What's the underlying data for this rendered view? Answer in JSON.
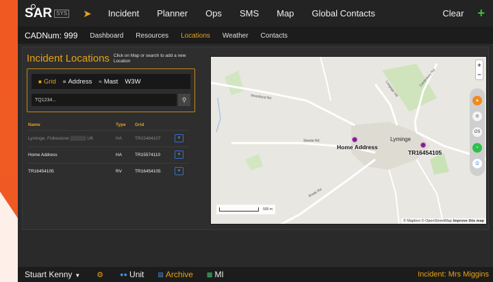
{
  "header": {
    "logo_s": "S",
    "logo_r": "AR",
    "logo_sys": "SYS",
    "nav": [
      "Incident",
      "Planner",
      "Ops",
      "SMS",
      "Map",
      "Global Contacts"
    ],
    "clear_label": "Clear",
    "add_label": "+"
  },
  "subnav": {
    "cad": "CADNum: 999",
    "tabs": [
      "Dashboard",
      "Resources",
      "Locations",
      "Weather",
      "Contacts"
    ],
    "active_tab": "Locations"
  },
  "locations": {
    "title": "Incident Locations",
    "hint": "Click on Map or search to add a new Location",
    "search_modes": [
      "Grid",
      "Address",
      "Mast",
      "W3W"
    ],
    "active_mode": "Grid",
    "search_placeholder": "TQ1234...",
    "table": {
      "headers": [
        "Name",
        "Type",
        "Grid"
      ],
      "rows": [
        {
          "name": "Lyminge, Folkestone ▒▒▒▒▒ UK",
          "type": "HA",
          "grid": "TR15484107"
        },
        {
          "name": "Home Address",
          "type": "HA",
          "grid": "TR15574110"
        },
        {
          "name": "TR16454105",
          "type": "RV",
          "grid": "TR16454105"
        }
      ]
    }
  },
  "map": {
    "labels": {
      "home": "Home Address",
      "lyminge": "Lyminge",
      "marker2": "TR16454105"
    },
    "roads": {
      "woodland": "Woodland Rd",
      "skeete": "Skeete Rd",
      "canterbury": "Canterbury Rd",
      "longage": "Longage Hill",
      "brady": "Brady Rd"
    },
    "scale_label": "500 m",
    "attribution_a": "© Mapbox © OpenStreetMap",
    "attribution_b": "Improve this map",
    "zoom_in": "+",
    "zoom_out": "−",
    "tool_os": "OS"
  },
  "footer": {
    "user": "Stuart Kenny",
    "unit_label": "Unit",
    "archive_label": "Archive",
    "mi_label": "MI",
    "incident": "Incident: Mrs Miggins"
  },
  "colors": {
    "accent": "#e8a318",
    "brand_orange": "#f05a22",
    "marker": "#7b1f86",
    "add_green": "#3cc63c"
  }
}
